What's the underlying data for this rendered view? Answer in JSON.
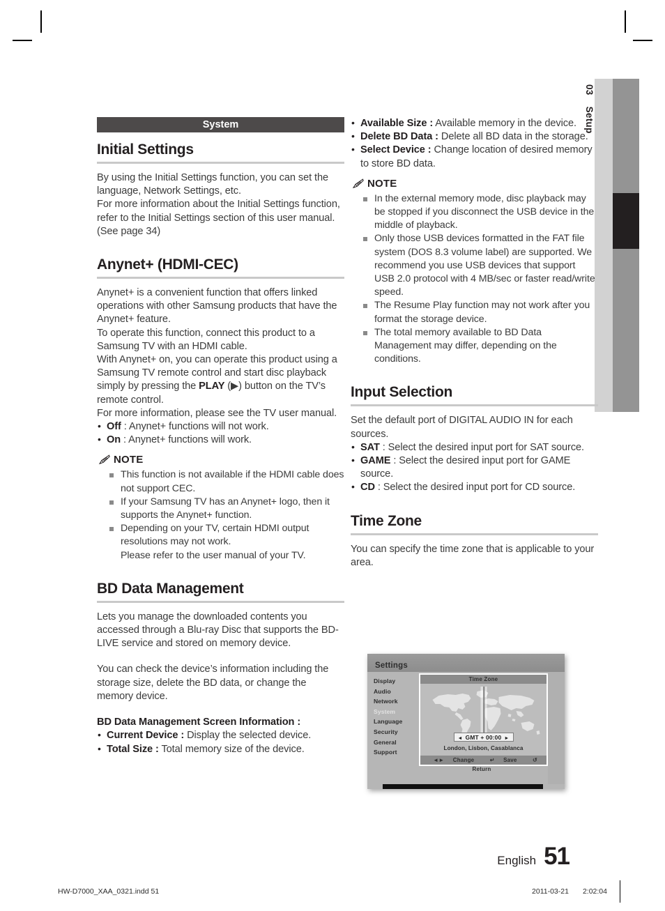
{
  "side_tab": {
    "number": "03",
    "label": "Setup"
  },
  "left_column": {
    "band_label": "System",
    "initial_settings": {
      "heading": "Initial Settings",
      "paragraph": "By using the Initial Settings function, you can set the language, Network Settings, etc.\nFor more information about the Initial Settings function, refer to the Initial Settings section of this user manual. (See page 34)"
    },
    "anynet": {
      "heading": "Anynet+ (HDMI-CEC)",
      "para1": "Anynet+ is a convenient function that offers linked operations with other Samsung products that have the Anynet+ feature.",
      "para2": "To operate this function, connect this product to a Samsung TV with an HDMI cable.",
      "para3_a": "With Anynet+ on, you can operate this product using a Samsung TV remote control and start disc playback simply by pressing the ",
      "para3_b": "PLAY",
      "para3_c": " (▶) button on the TV’s remote control.",
      "para4": "For more information, please see the TV user manual.",
      "options": [
        {
          "term": "Off",
          "desc": " : Anynet+ functions will not work."
        },
        {
          "term": "On",
          "desc": " : Anynet+ functions will work."
        }
      ],
      "note_label": "NOTE",
      "notes": [
        {
          "text": "This function is not available if the HDMI cable does not support CEC."
        },
        {
          "text": "If your Samsung TV has an Anynet+ logo, then it supports the Anynet+ function."
        },
        {
          "text": "Depending on your TV, certain HDMI output resolutions may not work.",
          "cont": "Please refer to the user manual of your TV."
        }
      ]
    },
    "bd_data": {
      "heading": "BD Data Management",
      "para1": "Lets you manage the downloaded contents you accessed through a Blu-ray Disc that supports the BD-LIVE service and stored on memory device.",
      "para2": "You can check the device’s information including the storage size, delete the BD data, or change the memory device.",
      "subheading": "BD Data Management Screen Information :",
      "items": [
        {
          "term": "Current Device :",
          "desc": " Display the selected device."
        },
        {
          "term": "Total Size :",
          "desc": " Total memory size of the device."
        }
      ]
    }
  },
  "right_column": {
    "bd_data_items_cont": [
      {
        "term": "Available Size :",
        "desc": " Available memory in the device."
      },
      {
        "term": "Delete BD Data :",
        "desc": " Delete all BD data in the storage."
      },
      {
        "term": "Select Device :",
        "desc": " Change location of desired memory to store BD data."
      }
    ],
    "note_label": "NOTE",
    "notes": [
      {
        "text": "In the external memory mode, disc playback may be stopped if you disconnect the USB device in the middle of playback."
      },
      {
        "text": "Only those USB devices formatted in the FAT file system (DOS 8.3 volume label) are supported. We recommend you use USB devices that support USB 2.0 protocol with 4 MB/sec or faster read/write speed."
      },
      {
        "text": "The Resume Play function may not work after you format the storage device."
      },
      {
        "text": "The total memory available to BD Data Management may differ, depending on the conditions."
      }
    ],
    "input_selection": {
      "heading": "Input Selection",
      "paragraph": "Set the default port of DIGITAL AUDIO IN for each sources.",
      "items": [
        {
          "term": "SAT",
          "desc": " : Select the desired input port for SAT source."
        },
        {
          "term": "GAME",
          "desc": " : Select the desired input port for GAME source."
        },
        {
          "term": "CD",
          "desc": " : Select the desired input port for CD source."
        }
      ]
    },
    "time_zone": {
      "heading": "Time Zone",
      "paragraph": "You can specify the time zone that is applicable to your area."
    }
  },
  "settings_screenshot": {
    "title": "Settings",
    "menu": [
      {
        "label": "Display",
        "selected": false
      },
      {
        "label": "Audio",
        "selected": false
      },
      {
        "label": "Network",
        "selected": false
      },
      {
        "label": "System",
        "selected": true
      },
      {
        "label": "Language",
        "selected": false
      },
      {
        "label": "Security",
        "selected": false
      },
      {
        "label": "General",
        "selected": false
      },
      {
        "label": "Support",
        "selected": false
      }
    ],
    "panel_title": "Time Zone",
    "gmt_left_arrow": "◄",
    "gmt_value": "GMT + 00:00",
    "gmt_right_arrow": "►",
    "cities": "London, Lisbon, Casablanca",
    "footer": [
      {
        "icon": "◄►",
        "label": "Change"
      },
      {
        "icon": "↵",
        "label": "Save"
      },
      {
        "icon": "↺",
        "label": "Return"
      }
    ]
  },
  "page_footer": {
    "language": "English",
    "page_number": "51",
    "file_name": "HW-D7000_XAA_0321.indd   51",
    "date": "2011-03-21",
    "time": "2:02:04"
  }
}
